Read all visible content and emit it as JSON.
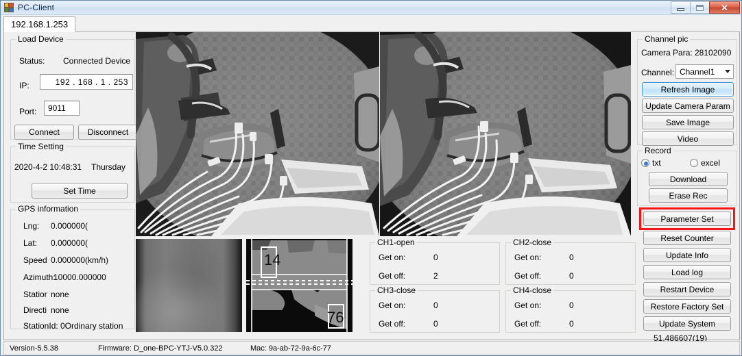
{
  "window": {
    "title": "PC-Client",
    "icon": "abc-blocks-icon",
    "minimize_label": "",
    "maximize_label": "",
    "close_label": "✕"
  },
  "tab": {
    "label": "192.168.1.253"
  },
  "load_device": {
    "legend": "Load Device",
    "status_label": "Status:",
    "status_value": "Connected Device",
    "ip_label": "IP:",
    "ip_value": "192 . 168 .  1   . 253",
    "port_label": "Port:",
    "port_value": "9011",
    "connect_label": "Connect",
    "disconnect_label": "Disconnect"
  },
  "time_setting": {
    "legend": "Time Setting",
    "datetime": "2020-4-2  10:48:31",
    "weekday": "Thursday",
    "set_time_label": "Set Time"
  },
  "gps": {
    "legend": "GPS information",
    "rows": [
      {
        "label": "Lng:",
        "value": "0.000000("
      },
      {
        "label": "Lat:",
        "value": "0.000000("
      },
      {
        "label": "Speed",
        "value": "0.000000(km/h)"
      },
      {
        "label": "Azimuth:",
        "value": "10000.000000"
      },
      {
        "label": "Statior",
        "value": "none"
      },
      {
        "label": "Directi",
        "value": "none"
      },
      {
        "label": "StationId:",
        "value": "0Ordinary station"
      }
    ]
  },
  "channels": [
    {
      "legend": "CH1-open",
      "get_on_label": "Get on:",
      "get_on_value": "0",
      "get_off_label": "Get off:",
      "get_off_value": "2"
    },
    {
      "legend": "CH2-close",
      "get_on_label": "Get on:",
      "get_on_value": "0",
      "get_off_label": "Get off:",
      "get_off_value": "0"
    },
    {
      "legend": "CH3-close",
      "get_on_label": "Get on:",
      "get_on_value": "0",
      "get_off_label": "Get off:",
      "get_off_value": "0"
    },
    {
      "legend": "CH4-close",
      "get_on_label": "Get on:",
      "get_on_value": "0",
      "get_off_label": "Get off:",
      "get_off_value": "0"
    }
  ],
  "channel_pic": {
    "legend": "Channel pic",
    "camera_para_label": "Camera Para:",
    "camera_para_value": "28102090",
    "channel_label": "Channel:",
    "channel_value": "Channel1",
    "refresh_label": "Refresh Image",
    "update_camera_param_label": "Update Camera Param",
    "save_image_label": "Save Image",
    "video_label": "Video"
  },
  "record": {
    "legend": "Record",
    "txt_label": "txt",
    "excel_label": "excel",
    "selected_format": "txt",
    "download_label": "Download",
    "erase_rec_label": "Erase Rec"
  },
  "actions": {
    "parameter_set_label": "Parameter Set",
    "reset_counter_label": "Reset Counter",
    "update_info_label": "Update Info",
    "load_log_label": "Load log",
    "restart_device_label": "Restart Device",
    "restore_factory_set_label": "Restore Factory Set",
    "update_system_label": "Update System",
    "bottom_value": "51.486607(19)"
  },
  "statusbar": {
    "version": "Version-5.5.38",
    "firmware": "Firmware: D_one-BPC-YTJ-V5.0.322",
    "mac": "Mac: 9a-ab-72-9a-6c-77"
  },
  "thumbnails": {
    "overlay_top": "14",
    "overlay_bottom": "76"
  },
  "colors": {
    "accent": "#3c93d4",
    "annotation": "#f41616",
    "panel": "#f0f0f0"
  }
}
